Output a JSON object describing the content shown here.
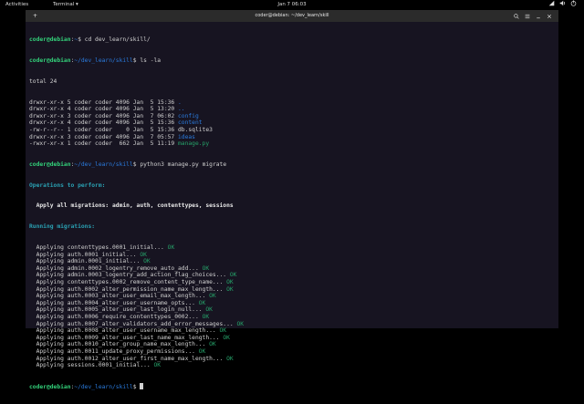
{
  "topbar": {
    "activities": "Activities",
    "app_menu": "Terminal ▾",
    "clock": "Jan 7  06:03",
    "tray_icons": [
      "network-icon",
      "volume-icon",
      "power-icon"
    ]
  },
  "window": {
    "title": "coder@debian: ~/dev_learn/skill"
  },
  "prompt": {
    "userhost": "coder@debian",
    "path1": "~",
    "path2": "~/dev_learn/skill"
  },
  "commands": {
    "cd": "cd dev_learn/skill/",
    "ls": "ls -la",
    "migrate": "python3 manage.py migrate"
  },
  "ls": {
    "total": "total 24",
    "rows": [
      {
        "meta": "drwxr-xr-x 5 coder coder 4096 Jan  5 15:36 ",
        "name": ".",
        "cls": "b"
      },
      {
        "meta": "drwxr-xr-x 4 coder coder 4096 Jan  5 13:20 ",
        "name": "..",
        "cls": "b"
      },
      {
        "meta": "drwxr-xr-x 3 coder coder 4096 Jan  7 06:02 ",
        "name": "config",
        "cls": "b"
      },
      {
        "meta": "drwxr-xr-x 4 coder coder 4096 Jan  5 15:36 ",
        "name": "content",
        "cls": "b"
      },
      {
        "meta": "-rw-r--r-- 1 coder coder    0 Jan  5 15:36 ",
        "name": "db.sqlite3",
        "cls": ""
      },
      {
        "meta": "drwxr-xr-x 3 coder coder 4096 Jan  7 05:57 ",
        "name": "ideas",
        "cls": "b"
      },
      {
        "meta": "-rwxr-xr-x 1 coder coder  662 Jan  5 11:19 ",
        "name": "manage.py",
        "cls": "g"
      }
    ]
  },
  "migrate": {
    "ops_header": "Operations to perform:",
    "apply_all": "  Apply all migrations: admin, auth, contenttypes, sessions",
    "running": "Running migrations:",
    "ok": "OK",
    "items": [
      "  Applying contenttypes.0001_initial... ",
      "  Applying auth.0001_initial... ",
      "  Applying admin.0001_initial... ",
      "  Applying admin.0002_logentry_remove_auto_add... ",
      "  Applying admin.0003_logentry_add_action_flag_choices... ",
      "  Applying contenttypes.0002_remove_content_type_name... ",
      "  Applying auth.0002_alter_permission_name_max_length... ",
      "  Applying auth.0003_alter_user_email_max_length... ",
      "  Applying auth.0004_alter_user_username_opts... ",
      "  Applying auth.0005_alter_user_last_login_null... ",
      "  Applying auth.0006_require_contenttypes_0002... ",
      "  Applying auth.0007_alter_validators_add_error_messages... ",
      "  Applying auth.0008_alter_user_username_max_length... ",
      "  Applying auth.0009_alter_user_last_name_max_length... ",
      "  Applying auth.0010_alter_group_name_max_length... ",
      "  Applying auth.0011_update_proxy_permissions... ",
      "  Applying auth.0012_alter_user_first_name_max_length... ",
      "  Applying sessions.0001_initial... "
    ]
  }
}
